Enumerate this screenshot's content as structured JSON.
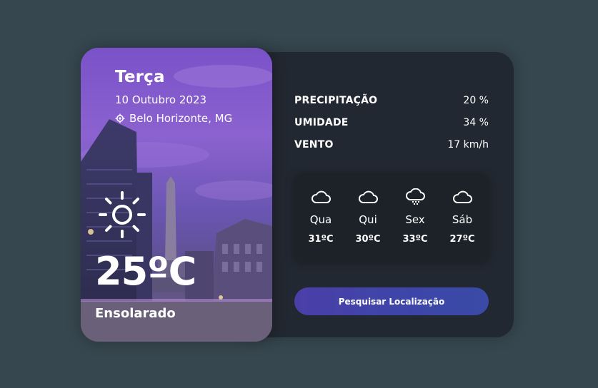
{
  "current": {
    "day": "Terça",
    "date": "10 Outubro 2023",
    "location": "Belo Horizonte, MG",
    "location_icon": "location-pin-icon",
    "condition_icon": "sun-icon",
    "temperature": "25ºC",
    "condition": "Ensolarado"
  },
  "stats": [
    {
      "label": "PRECIPITAÇÃO",
      "value": "20 %"
    },
    {
      "label": "UMIDADE",
      "value": "34 %"
    },
    {
      "label": "VENTO",
      "value": "17 km/h"
    }
  ],
  "forecast": [
    {
      "day": "Qua",
      "temp": "31ºC",
      "icon": "cloud-icon"
    },
    {
      "day": "Qui",
      "temp": "30ºC",
      "icon": "cloud-icon"
    },
    {
      "day": "Sex",
      "temp": "33ºC",
      "icon": "cloud-snow-icon"
    },
    {
      "day": "Sáb",
      "temp": "27ºC",
      "icon": "cloud-icon"
    }
  ],
  "search_button": {
    "label": "Pesquisar Localização"
  },
  "colors": {
    "background": "#37474f",
    "panel": "#222831",
    "accent": "#3d46a8"
  }
}
